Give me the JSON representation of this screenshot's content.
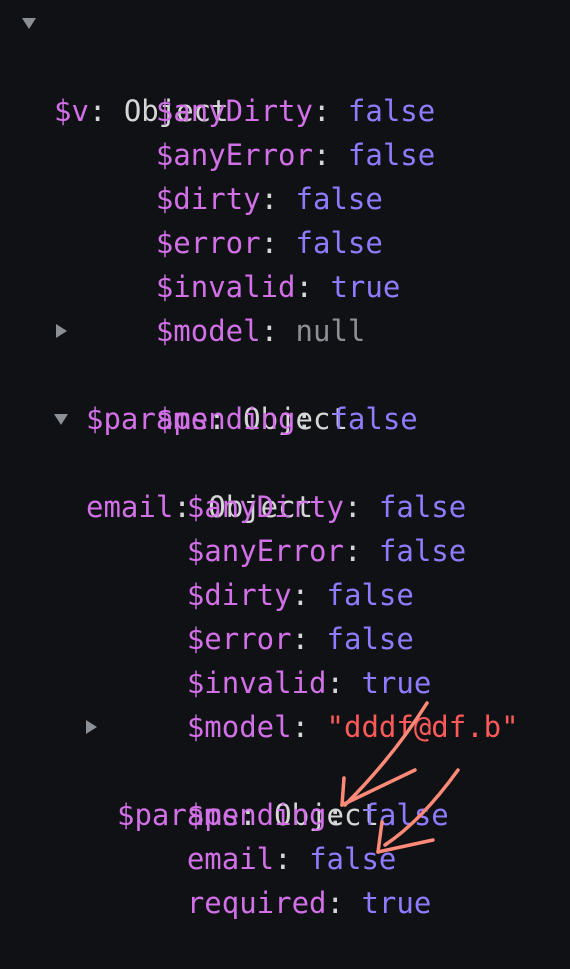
{
  "root": {
    "key": "$v",
    "value": "Object",
    "children": [
      {
        "key": "$anyDirty",
        "value": "false"
      },
      {
        "key": "$anyError",
        "value": "false"
      },
      {
        "key": "$dirty",
        "value": "false"
      },
      {
        "key": "$error",
        "value": "false"
      },
      {
        "key": "$invalid",
        "value": "true"
      },
      {
        "key": "$model",
        "value": "null"
      },
      {
        "key": "$params",
        "value": "Object"
      },
      {
        "key": "$pending",
        "value": "false"
      }
    ],
    "email": {
      "key": "email",
      "value": "Object",
      "children": [
        {
          "key": "$anyDirty",
          "value": "false"
        },
        {
          "key": "$anyError",
          "value": "false"
        },
        {
          "key": "$dirty",
          "value": "false"
        },
        {
          "key": "$error",
          "value": "false"
        },
        {
          "key": "$invalid",
          "value": "true"
        },
        {
          "key": "$model",
          "value": "\"dddf@df.b\""
        },
        {
          "key": "$params",
          "value": "Object"
        },
        {
          "key": "$pending",
          "value": "false"
        },
        {
          "key": "email",
          "value": "false"
        },
        {
          "key": "required",
          "value": "true"
        }
      ]
    }
  },
  "colors": {
    "background": "#0f1114",
    "key": "#d270e7",
    "boolean": "#8f7bff",
    "string": "#ff5a5a",
    "null": "#8b8f96",
    "annotation": "#ff8a78"
  },
  "icons": [
    "caret-down-icon",
    "caret-right-icon",
    "arrow-annotation"
  ]
}
